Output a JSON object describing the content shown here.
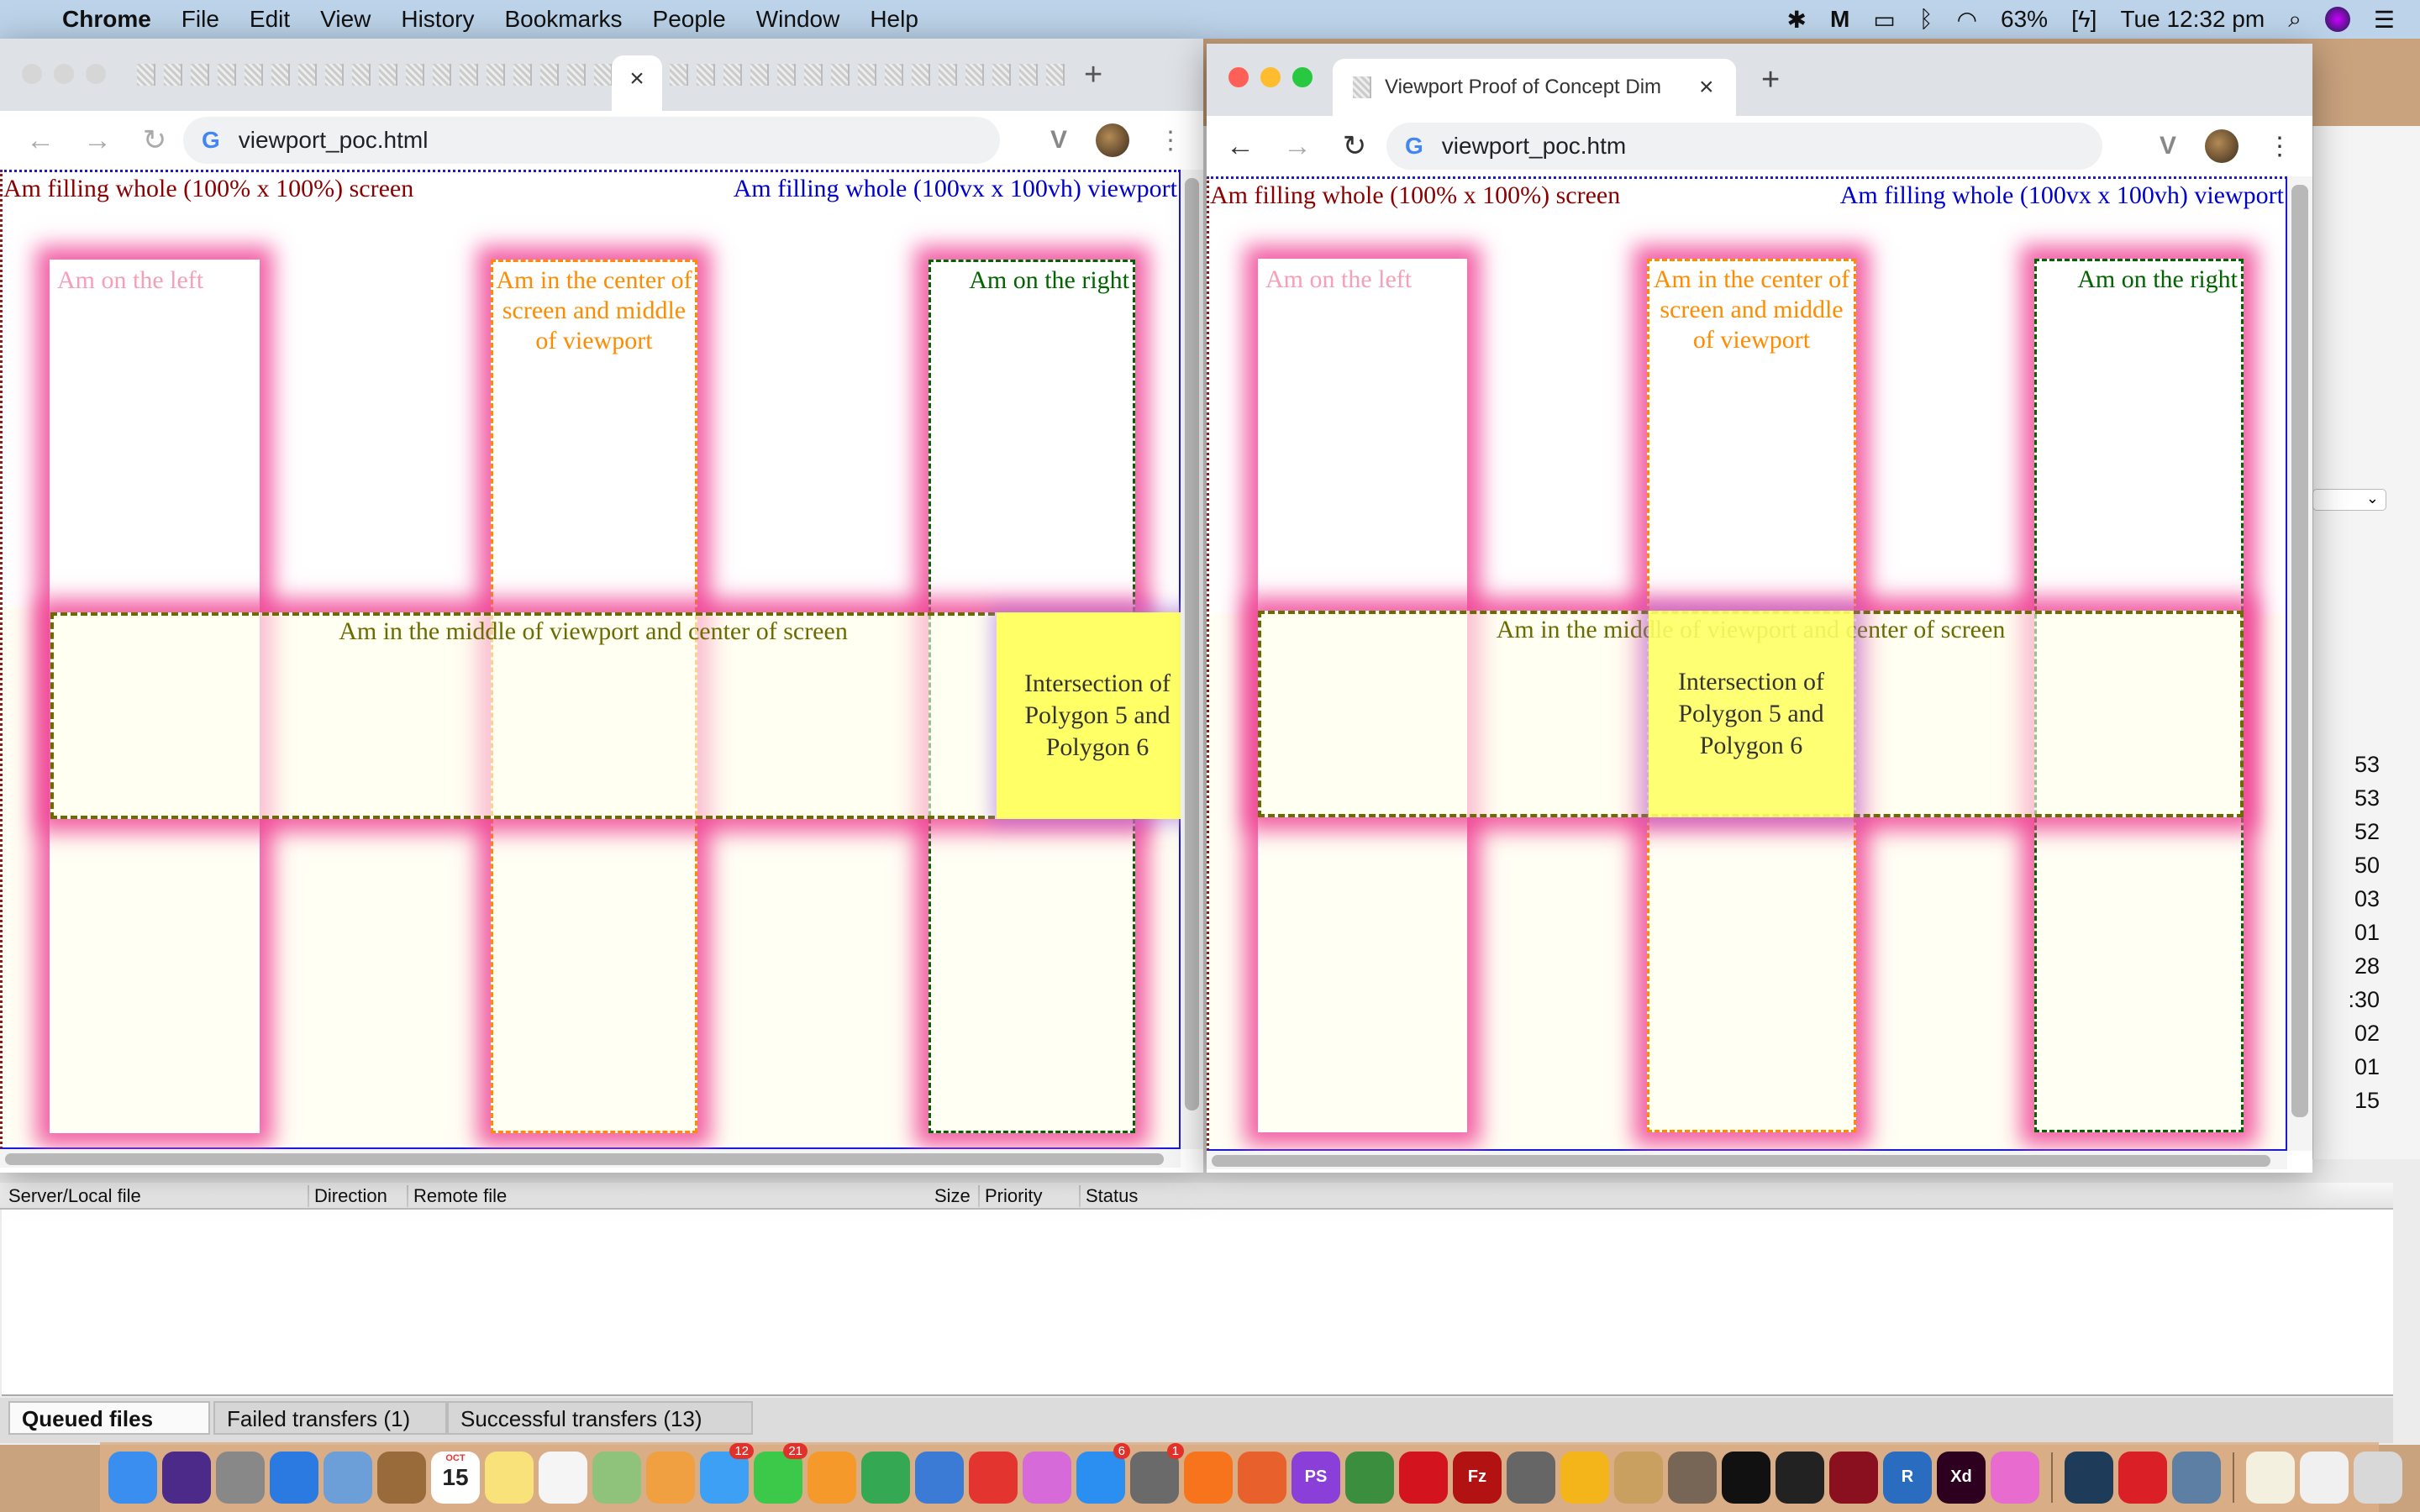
{
  "menubar": {
    "apple_icon": "apple-logo-icon",
    "app": "Chrome",
    "items": [
      "File",
      "Edit",
      "View",
      "History",
      "Bookmarks",
      "People",
      "Window",
      "Help"
    ],
    "status_icons": [
      "avast-icon",
      "malwarebytes-icon",
      "airplay-icon",
      "bluetooth-icon",
      "wifi-icon"
    ],
    "battery": "63%",
    "clock": "Tue 12:32 pm",
    "right_icons": [
      "spotlight-search-icon",
      "siri-icon",
      "notification-center-icon"
    ]
  },
  "left_window": {
    "tab_close": "×",
    "new_tab": "+",
    "url": "viewport_poc.html",
    "back": "←",
    "forward": "→",
    "reload": "↻",
    "menu": "⋮",
    "vivaldi": "V"
  },
  "right_window": {
    "tab_title": "Viewport Proof of Concept Dim",
    "tab_close": "×",
    "new_tab": "+",
    "url": "viewport_poc.htm",
    "back": "←",
    "forward": "→",
    "reload": "↻",
    "menu": "⋮",
    "vivaldi": "V"
  },
  "page": {
    "screen_label": "Am filling whole (100% x 100%) screen",
    "viewport_label": "Am filling whole (100vx x 100vh) viewport",
    "left": "Am on the left",
    "center": "Am in the center of screen and middle of viewport",
    "right": "Am on the right",
    "middle": "Am in the middle of viewport and center of screen",
    "intersection": "Intersection of Polygon 5 and Polygon 6"
  },
  "colors": {
    "screen_label": "#8b0000",
    "viewport_label": "#0000cd",
    "center": "#ff8c00",
    "right": "#006400",
    "middle": "#6b6b00",
    "intersection": "#ffff66",
    "glow": "#f04696"
  },
  "filezilla": {
    "columns": [
      "Server/Local file",
      "Direction",
      "Remote file",
      "Size",
      "Priority",
      "Status"
    ],
    "tabs": [
      "Queued files",
      "Failed transfers (1)",
      "Successful transfers (13)"
    ],
    "partial_times": [
      "53",
      "53",
      "52",
      "50",
      "03",
      "01",
      "28",
      ":30",
      "02",
      "01",
      "15"
    ]
  },
  "dock": {
    "apps": [
      {
        "icon": "finder-icon",
        "color": "#3a8ef0"
      },
      {
        "icon": "siri-icon",
        "color": "#4b2a8a"
      },
      {
        "icon": "launchpad-icon",
        "color": "#888"
      },
      {
        "icon": "safari-icon",
        "color": "#2a7ae2"
      },
      {
        "icon": "mail-icon",
        "color": "#6c9fd8"
      },
      {
        "icon": "contacts-icon",
        "color": "#9a6b3a"
      },
      {
        "icon": "calendar-icon",
        "color": "#fff",
        "text": "15"
      },
      {
        "icon": "notes-icon",
        "color": "#f9e27a"
      },
      {
        "icon": "reminders-icon",
        "color": "#f5f5f5"
      },
      {
        "icon": "maps-icon",
        "color": "#8fc27a"
      },
      {
        "icon": "photos-icon",
        "color": "#f0a040"
      },
      {
        "icon": "messages-icon",
        "color": "#3ea0f5",
        "badge": "12"
      },
      {
        "icon": "facetime-icon",
        "color": "#3cc94a",
        "badge": "21"
      },
      {
        "icon": "pages-icon",
        "color": "#f59a2a"
      },
      {
        "icon": "numbers-icon",
        "color": "#34a853"
      },
      {
        "icon": "keynote-icon",
        "color": "#3b7bd6"
      },
      {
        "icon": "news-icon",
        "color": "#e3342f"
      },
      {
        "icon": "itunes-icon",
        "color": "#d56ad8"
      },
      {
        "icon": "app-store-icon",
        "color": "#2a8ff0",
        "badge": "6"
      },
      {
        "icon": "system-preferences-icon",
        "color": "#6a6a6a",
        "badge": "1"
      },
      {
        "icon": "avast-icon",
        "color": "#f7731c"
      },
      {
        "icon": "firefox-icon",
        "color": "#e8602c"
      },
      {
        "icon": "phpstorm-icon",
        "color": "#8b3fd9",
        "text": "PS"
      },
      {
        "icon": "chrome-icon",
        "color": "#3b8e3e"
      },
      {
        "icon": "opera-icon",
        "color": "#d3141e"
      },
      {
        "icon": "filezilla-icon",
        "color": "#b31212",
        "text": "Fz"
      },
      {
        "icon": "tableplus-icon",
        "color": "#666"
      },
      {
        "icon": "coda-icon",
        "color": "#f4b51a"
      },
      {
        "icon": "paint-icon",
        "color": "#c9a060"
      },
      {
        "icon": "gimp-icon",
        "color": "#776655"
      },
      {
        "icon": "terminal-icon",
        "color": "#111"
      },
      {
        "icon": "inkscape-icon",
        "color": "#222"
      },
      {
        "icon": "photo-booth-icon",
        "color": "#8a1020"
      },
      {
        "icon": "r-icon",
        "color": "#2a6cc0",
        "text": "R"
      },
      {
        "icon": "adobe-xd-icon",
        "color": "#2e001f",
        "text": "Xd"
      },
      {
        "icon": "sketch-icon",
        "color": "#e86cd0"
      },
      {
        "sep": true
      },
      {
        "icon": "quicktime-icon",
        "color": "#1f3b5a"
      },
      {
        "icon": "creative-cloud-icon",
        "color": "#da1f26"
      },
      {
        "icon": "preview-icon",
        "color": "#5d7fa3"
      },
      {
        "sep": true
      },
      {
        "icon": "document-stack-icon",
        "color": "#f3f0e0"
      },
      {
        "icon": "downloads-stack-icon",
        "color": "#f0f0f0"
      },
      {
        "icon": "trash-icon",
        "color": "#d8d8d8"
      }
    ],
    "calendar_month": "OCT"
  }
}
